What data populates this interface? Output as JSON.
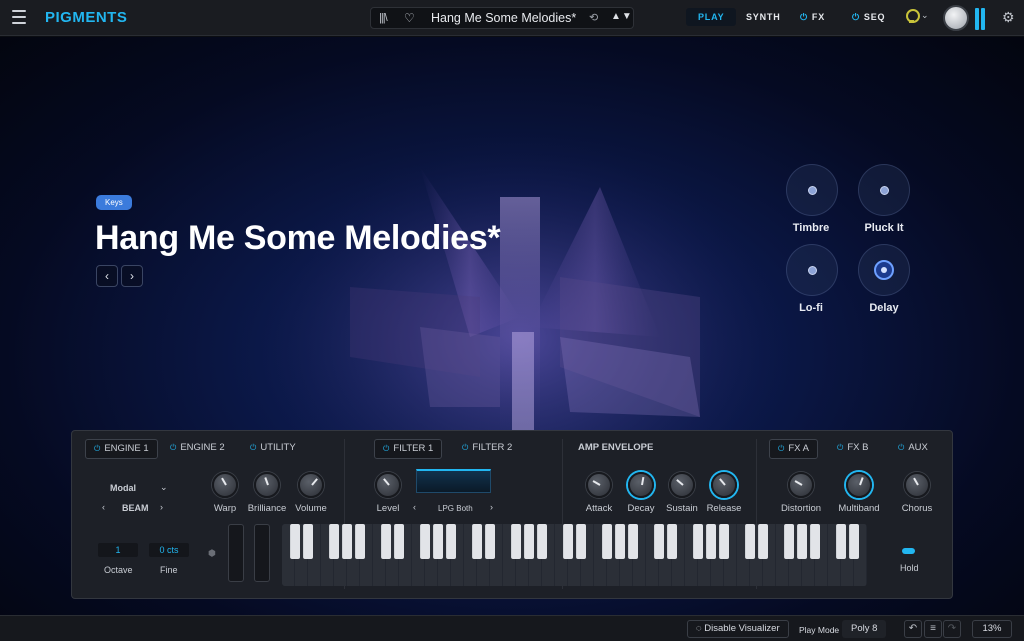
{
  "app": {
    "brand": "PIGMENTS"
  },
  "preset": {
    "name": "Hang Me Some Melodies*",
    "library_icon": "library-icon",
    "heart_icon": "heart-icon",
    "arrows": "▲▼"
  },
  "nav": {
    "play": "PLAY",
    "synth": "SYNTH",
    "fx": "FX",
    "seq": "SEQ"
  },
  "hero": {
    "category": "Keys",
    "title": "Hang Me Some Melodies*",
    "prev": "‹",
    "next": "›"
  },
  "macros": [
    "Timbre",
    "Pluck It",
    "Lo-fi",
    "Delay"
  ],
  "panel": {
    "engine_tabs": [
      "ENGINE 1",
      "ENGINE 2",
      "UTILITY"
    ],
    "filter_tabs": [
      "FILTER 1",
      "FILTER 2"
    ],
    "amp": "AMP ENVELOPE",
    "fx_tabs": [
      "FX A",
      "FX B",
      "AUX"
    ],
    "engine_mode": "Modal",
    "engine_type": "BEAM",
    "engine_knobs": [
      "Warp",
      "Brilliance",
      "Volume"
    ],
    "filter_knob": "Level",
    "filter_type": "LPG Both",
    "env_knobs": [
      "Attack",
      "Decay",
      "Sustain",
      "Release"
    ],
    "fx_knobs": [
      "Distortion",
      "Multiband",
      "Chorus"
    ],
    "octave_value": "1",
    "octave_label": "Octave",
    "fine_value": "0 cts",
    "fine_label": "Fine",
    "hold": "Hold"
  },
  "status": {
    "visualizer": "Disable Visualizer",
    "play_mode_label": "Play Mode",
    "play_mode_value": "Poly 8",
    "cpu": "13%"
  },
  "colors": {
    "accent": "#22b6f0",
    "category": "#3b7bdc"
  }
}
